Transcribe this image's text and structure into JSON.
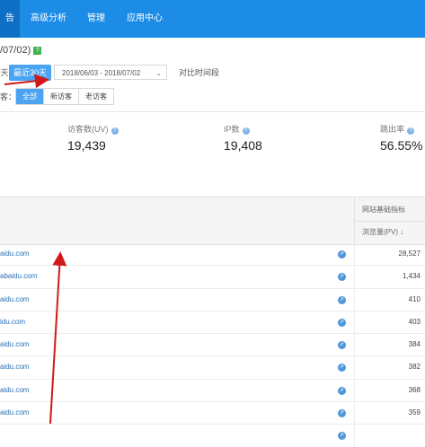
{
  "nav": {
    "active_fragment": "告",
    "items": [
      "高级分析",
      "管理",
      "应用中心"
    ]
  },
  "date_range_label": "/07/02)",
  "date_badge": "?",
  "range": {
    "day_fragment": "天",
    "last30_label": "最近30天",
    "date_value": "2018/06/03 - 2018/07/02",
    "compare_label": "对比时间段"
  },
  "visitor_filter": {
    "label_fragment": "客：",
    "options": [
      "全部",
      "新访客",
      "老访客"
    ],
    "selected": "全部"
  },
  "stats": [
    {
      "label": "访客数(UV)",
      "value": "19,439"
    },
    {
      "label": "IP数",
      "value": "19,408"
    },
    {
      "label": "跳出率",
      "value": "56.55%"
    }
  ],
  "table": {
    "group_header": "网站基础指标",
    "pv_header": "浏览量(PV)",
    "sort_icon": "arrow-down-icon",
    "rows": [
      {
        "url": "aidu.com",
        "pv": "28,527"
      },
      {
        "url": "abaidu.com",
        "pv": "1,434"
      },
      {
        "url": "aidu.com",
        "pv": "410"
      },
      {
        "url": "idu.com",
        "pv": "403"
      },
      {
        "url": "aidu.com",
        "pv": "384"
      },
      {
        "url": "aidu.com",
        "pv": "382"
      },
      {
        "url": "aidu.com",
        "pv": "368"
      },
      {
        "url": "aidu.com",
        "pv": "359"
      },
      {
        "url": "",
        "pv": ""
      }
    ]
  },
  "colors": {
    "nav_bg": "#1c8ce6",
    "accent": "#4aa4f2",
    "annotation_red": "#d01a1a"
  }
}
